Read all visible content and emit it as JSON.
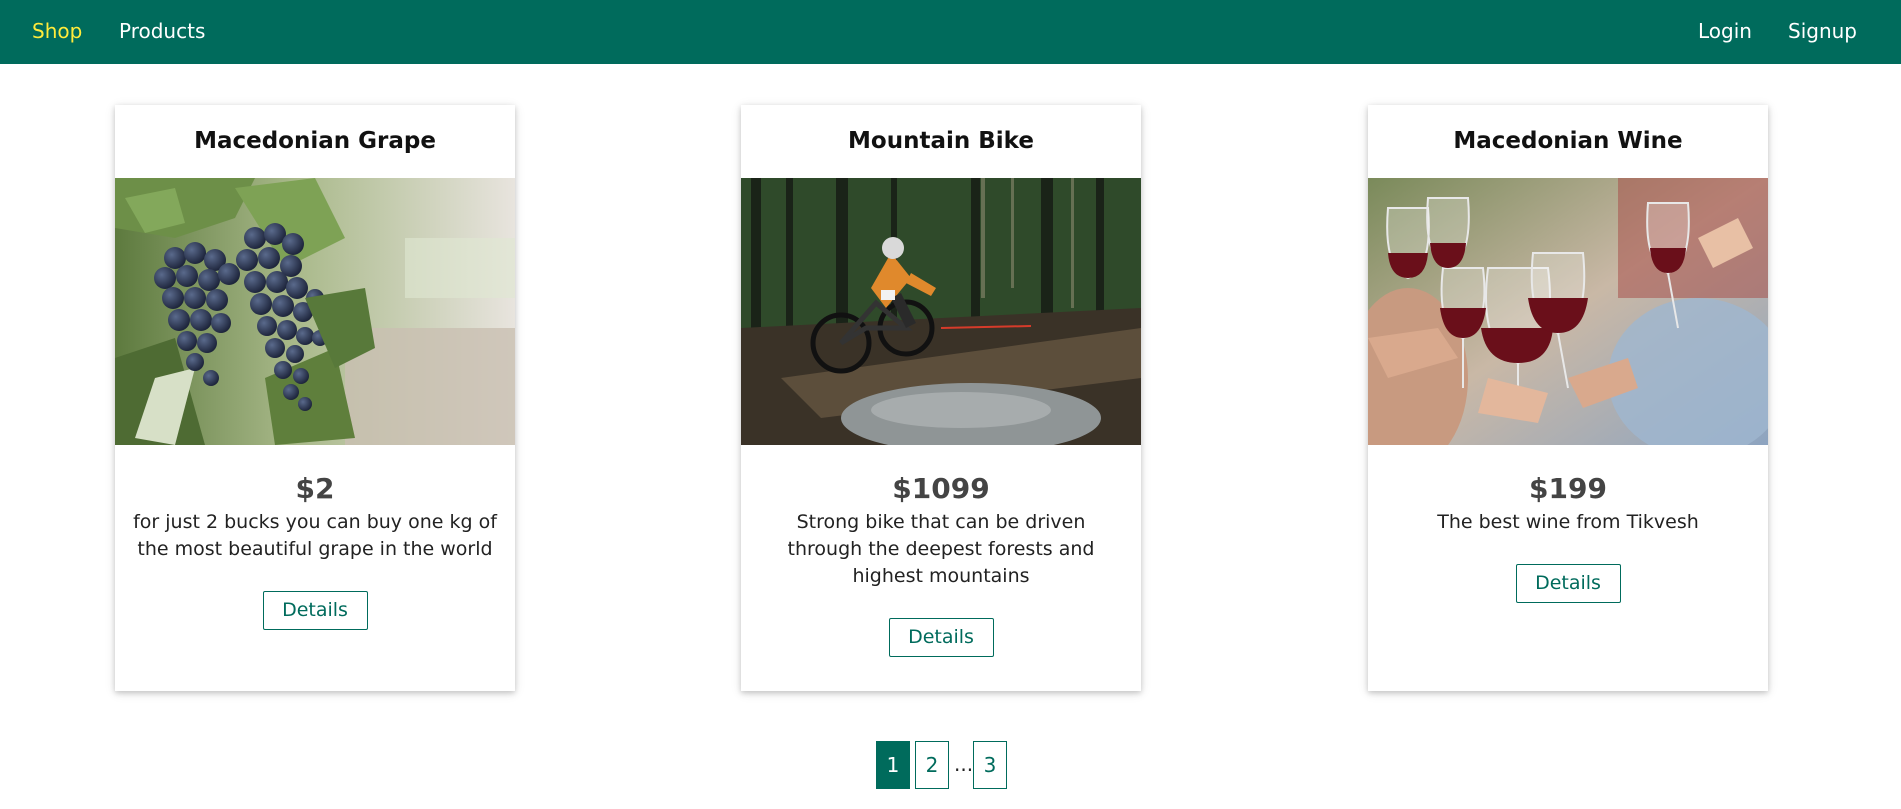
{
  "nav": {
    "left": [
      {
        "label": "Shop",
        "active": true
      },
      {
        "label": "Products",
        "active": false
      }
    ],
    "right": [
      {
        "label": "Login"
      },
      {
        "label": "Signup"
      }
    ],
    "color": "#006b5c",
    "active_color": "#ffeb3b"
  },
  "cards": [
    {
      "title": "Macedonian Grape",
      "image": "grape-vineyard-image",
      "price": "$2",
      "description": "for just 2 bucks you can buy one kg of the most beautiful grape in the world",
      "button": "Details"
    },
    {
      "title": "Mountain Bike",
      "image": "mountain-bike-forest-image",
      "price": "$1099",
      "description": "Strong bike that can be driven through the deepest forests and highest mountains",
      "button": "Details"
    },
    {
      "title": "Macedonian Wine",
      "image": "wine-glasses-toast-image",
      "price": "$199",
      "description": "The best wine from Tikvesh",
      "button": "Details"
    }
  ],
  "pagination": {
    "pages": [
      "1",
      "2",
      "3"
    ],
    "ellipsis": "...",
    "current": "1"
  }
}
